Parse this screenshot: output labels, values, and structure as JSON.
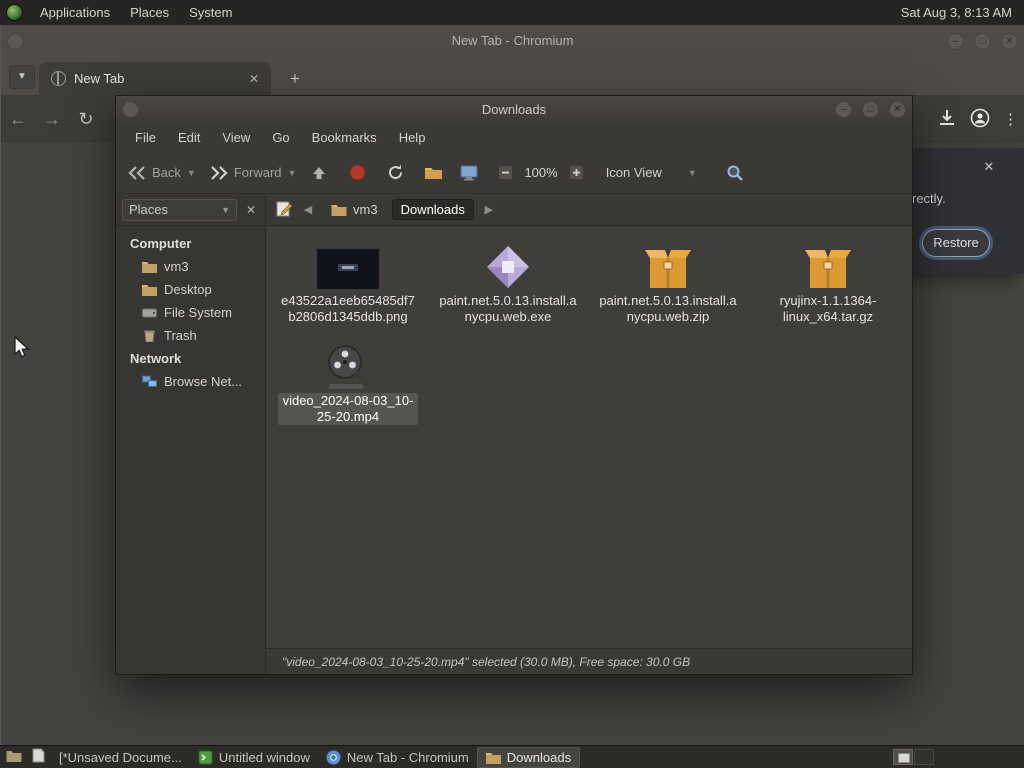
{
  "desktop": {
    "panel": {
      "menus": [
        "Applications",
        "Places",
        "System"
      ],
      "clock": "Sat Aug 3, 8:13 AM"
    },
    "taskbar": {
      "tasks": [
        "[*Unsaved Docume...",
        "Untitled window",
        "New Tab - Chromium",
        "Downloads"
      ]
    }
  },
  "chromium": {
    "window_title": "New Tab - Chromium",
    "tab_label": "New Tab",
    "new_tab_glyph": "+",
    "bubble": {
      "text": "rectly.",
      "restore": "Restore"
    }
  },
  "filemanager": {
    "window_title": "Downloads",
    "menus": [
      "File",
      "Edit",
      "View",
      "Go",
      "Bookmarks",
      "Help"
    ],
    "toolbar": {
      "back": "Back",
      "forward": "Forward",
      "zoom": "100%",
      "view_mode": "Icon View"
    },
    "pathbar": {
      "place": "vm3",
      "current": "Downloads"
    },
    "sidebar": {
      "header": "Places",
      "computer_label": "Computer",
      "network_label": "Network",
      "items": [
        "vm3",
        "Desktop",
        "File System",
        "Trash"
      ],
      "network_items": [
        "Browse Net..."
      ]
    },
    "files": [
      {
        "name": "e43522a1eeb65485df7b2806d1345ddb.png"
      },
      {
        "name": "paint.net.5.0.13.install.anycpu.web.exe"
      },
      {
        "name": "paint.net.5.0.13.install.anycpu.web.zip"
      },
      {
        "name": "ryujinx-1.1.1364-linux_x64.tar.gz"
      },
      {
        "name": "video_2024-08-03_10-25-20.mp4"
      }
    ],
    "statusbar": "\"video_2024-08-03_10-25-20.mp4\" selected (30.0 MB), Free space: 30.0 GB"
  }
}
